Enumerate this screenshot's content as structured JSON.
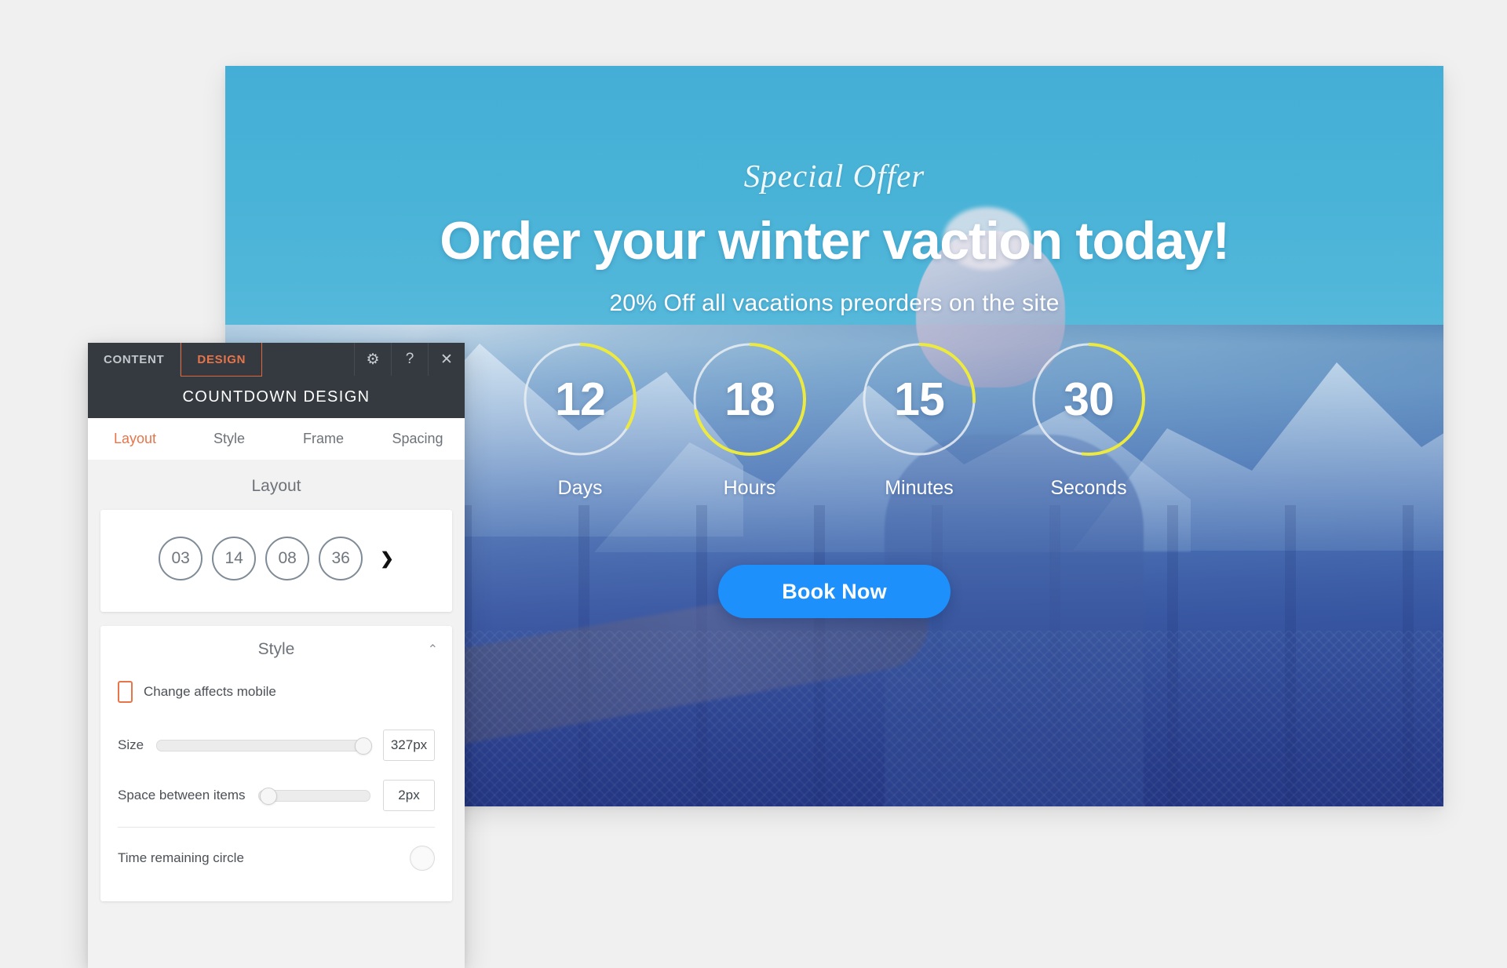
{
  "hero": {
    "eyebrow": "Special Offer",
    "headline": "Order your winter vaction today!",
    "subheadline": "20% Off all vacations preorders on the site",
    "cta_label": "Book Now",
    "cta_color": "#1e90fb",
    "countdown": [
      {
        "value": "12",
        "label": "Days",
        "progress_pct": 34,
        "arc_color": "#ecea3f",
        "track_color": "#e9eef2"
      },
      {
        "value": "18",
        "label": "Hours",
        "progress_pct": 72,
        "arc_color": "#ecea3f",
        "track_color": "#e9eef2"
      },
      {
        "value": "15",
        "label": "Minutes",
        "progress_pct": 26,
        "arc_color": "#ecea3f",
        "track_color": "#e9eef2"
      },
      {
        "value": "30",
        "label": "Seconds",
        "progress_pct": 52,
        "arc_color": "#ecea3f",
        "track_color": "#e9eef2"
      }
    ]
  },
  "panel": {
    "top_tabs": [
      {
        "label": "CONTENT",
        "active": false
      },
      {
        "label": "DESIGN",
        "active": true
      }
    ],
    "top_icons": [
      {
        "name": "gear-icon",
        "glyph": "⚙"
      },
      {
        "name": "help-icon",
        "glyph": "?"
      },
      {
        "name": "close-icon",
        "glyph": "✕"
      }
    ],
    "title": "COUNTDOWN DESIGN",
    "tabs": [
      {
        "label": "Layout",
        "active": true
      },
      {
        "label": "Style",
        "active": false
      },
      {
        "label": "Frame",
        "active": false
      },
      {
        "label": "Spacing",
        "active": false
      }
    ],
    "layout_section": {
      "heading": "Layout",
      "preview_values": [
        "03",
        "14",
        "08",
        "36"
      ],
      "next_glyph": "❯"
    },
    "style_section": {
      "heading": "Style",
      "collapse_glyph": "⌃",
      "mobile_note": "Change affects mobile",
      "controls": [
        {
          "label": "Size",
          "value": "327px",
          "slider_pct": 100
        },
        {
          "label": "Space between items",
          "value": "2px",
          "slider_pct": 2
        }
      ],
      "toggle_row": {
        "label": "Time remaining circle"
      }
    },
    "accent_color": "#e8744a",
    "header_bg": "#343a40"
  }
}
